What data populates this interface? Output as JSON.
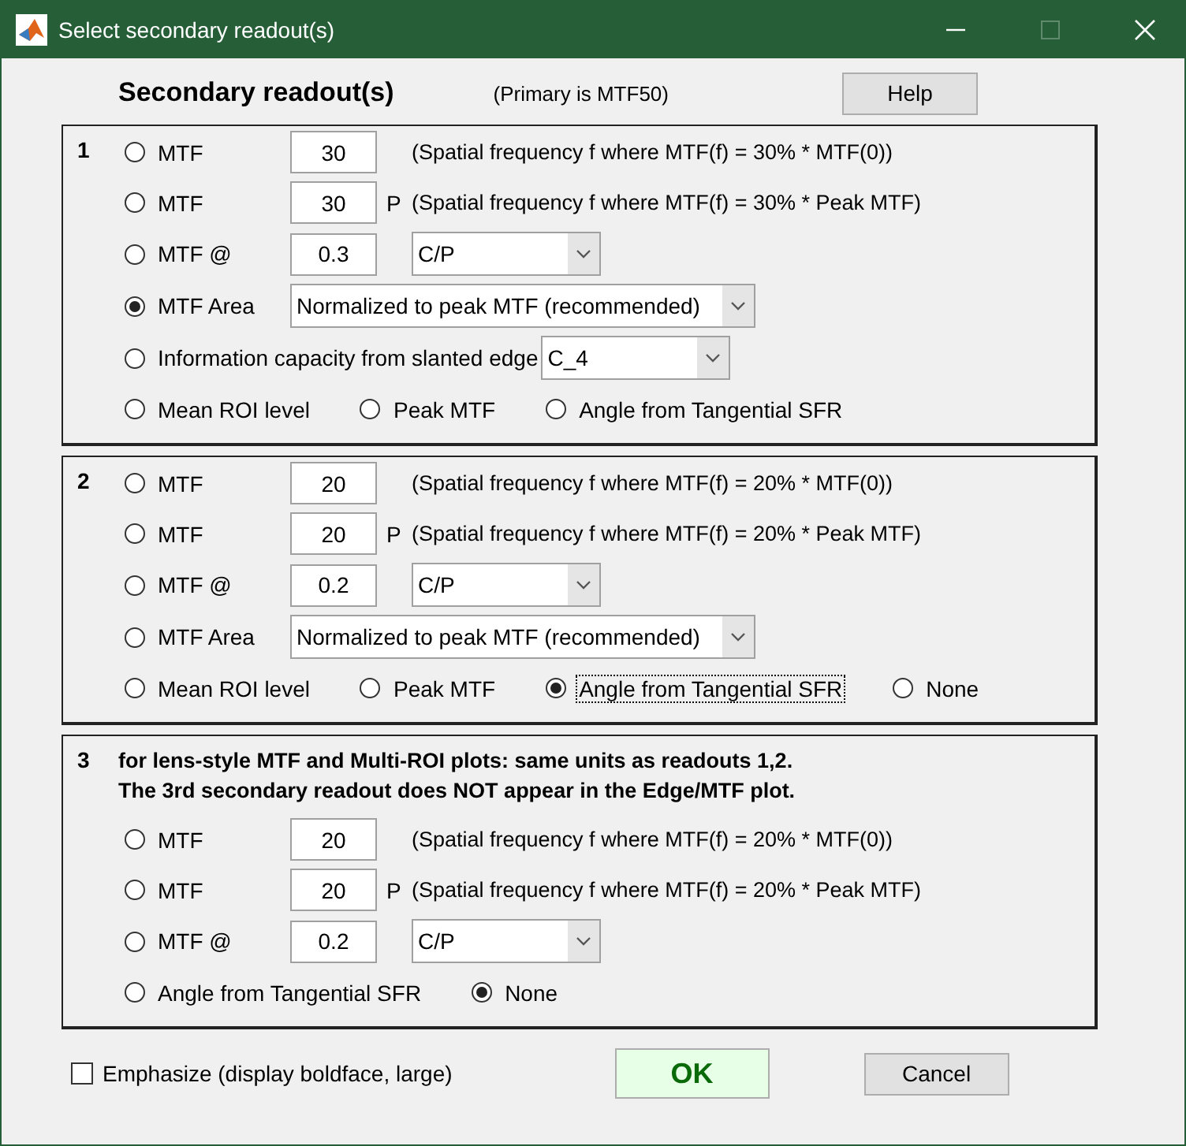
{
  "window": {
    "title": "Select secondary readout(s)",
    "maximize_disabled": true
  },
  "header": {
    "title": "Secondary readout(s)",
    "note": "(Primary is MTF50)",
    "help_button": "Help"
  },
  "sections": [
    {
      "number": "1",
      "rows": [
        {
          "kind": "threshold",
          "radio": {
            "label": "MTF",
            "selected": false,
            "focused": false
          },
          "value": "30",
          "description": "(Spatial frequency f where MTF(f) = 30% * MTF(0))"
        },
        {
          "kind": "threshold",
          "radio": {
            "label": "MTF",
            "selected": false,
            "focused": false
          },
          "value": "30",
          "peak_mark": "P",
          "description": "(Spatial frequency f where MTF(f) = 30% * Peak MTF)"
        },
        {
          "kind": "at",
          "radio": {
            "label": "MTF @",
            "selected": false,
            "focused": false
          },
          "value": "0.3",
          "unit": "C/P"
        },
        {
          "kind": "choice",
          "radio": {
            "label": "MTF Area",
            "selected": true,
            "focused": false
          },
          "choice": "Normalized to peak MTF (recommended)"
        },
        {
          "kind": "choice",
          "radio": {
            "label": "Information capacity from slanted edge",
            "selected": false,
            "focused": false
          },
          "choice": "C_4"
        },
        {
          "kind": "options",
          "options": [
            {
              "label": "Mean ROI level",
              "selected": false,
              "focused": false
            },
            {
              "label": "Peak MTF",
              "selected": false,
              "focused": false
            },
            {
              "label": "Angle from Tangential SFR",
              "selected": false,
              "focused": false
            }
          ]
        }
      ]
    },
    {
      "number": "2",
      "rows": [
        {
          "kind": "threshold",
          "radio": {
            "label": "MTF",
            "selected": false,
            "focused": false
          },
          "value": "20",
          "description": "(Spatial frequency f where MTF(f) = 20% * MTF(0))"
        },
        {
          "kind": "threshold",
          "radio": {
            "label": "MTF",
            "selected": false,
            "focused": false
          },
          "value": "20",
          "peak_mark": "P",
          "description": "(Spatial frequency f where MTF(f) = 20% * Peak MTF)"
        },
        {
          "kind": "at",
          "radio": {
            "label": "MTF @",
            "selected": false,
            "focused": false
          },
          "value": "0.2",
          "unit": "C/P"
        },
        {
          "kind": "choice",
          "radio": {
            "label": "MTF Area",
            "selected": false,
            "focused": false
          },
          "choice": "Normalized to peak MTF (recommended)"
        },
        {
          "kind": "options",
          "options": [
            {
              "label": "Mean ROI level",
              "selected": false,
              "focused": false
            },
            {
              "label": "Peak MTF",
              "selected": false,
              "focused": false
            },
            {
              "label": "Angle from Tangential SFR",
              "selected": true,
              "focused": true
            },
            {
              "label": "None",
              "selected": false,
              "focused": false
            }
          ]
        }
      ]
    },
    {
      "number": "3",
      "notes": [
        "for lens-style MTF and Multi-ROI plots:  same units as readouts 1,2.",
        "The 3rd secondary readout does NOT appear in the Edge/MTF plot."
      ],
      "rows": [
        {
          "kind": "threshold",
          "radio": {
            "label": "MTF",
            "selected": false,
            "focused": false
          },
          "value": "20",
          "description": "(Spatial frequency f where MTF(f) = 20% * MTF(0))"
        },
        {
          "kind": "threshold",
          "radio": {
            "label": "MTF",
            "selected": false,
            "focused": false
          },
          "value": "20",
          "peak_mark": "P",
          "description": "(Spatial frequency f where MTF(f) = 20% * Peak MTF)"
        },
        {
          "kind": "at",
          "radio": {
            "label": "MTF @",
            "selected": false,
            "focused": false
          },
          "value": "0.2",
          "unit": "C/P"
        },
        {
          "kind": "options",
          "options": [
            {
              "label": "Angle from Tangential SFR",
              "selected": false,
              "focused": false
            },
            {
              "label": "None",
              "selected": true,
              "focused": false
            }
          ]
        }
      ]
    }
  ],
  "footer": {
    "emphasize": {
      "label": "Emphasize (display boldface, large)",
      "checked": false
    },
    "ok_button": "OK",
    "cancel_button": "Cancel"
  }
}
